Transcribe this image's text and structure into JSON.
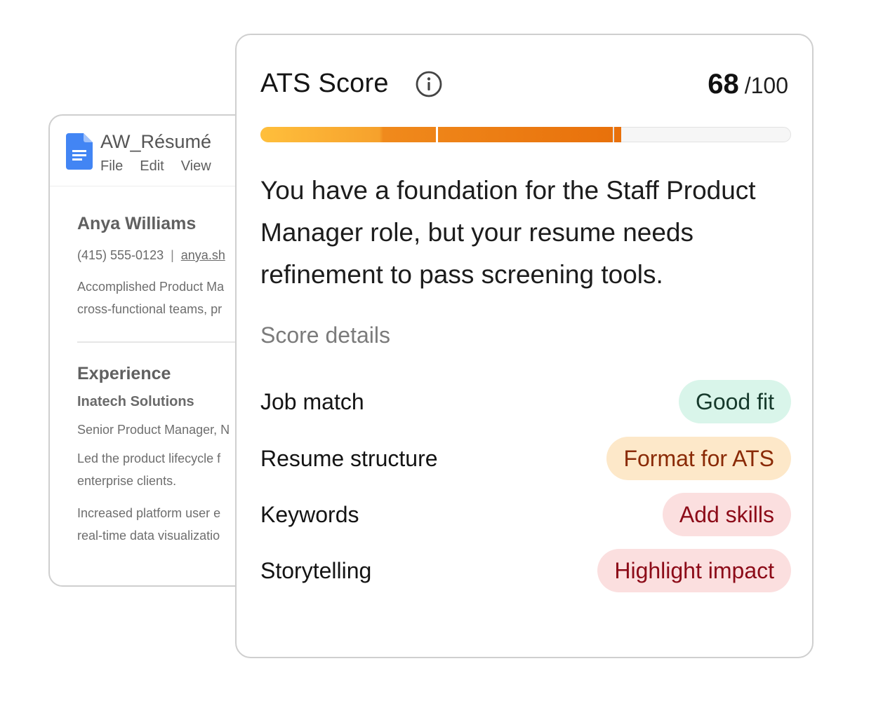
{
  "document": {
    "title": "AW_Résumé",
    "menu": [
      "File",
      "Edit",
      "View"
    ],
    "name": "Anya Williams",
    "phone": "(415) 555-0123",
    "separator": "|",
    "link": "anya.sh",
    "summary_lines": [
      "Accomplished Product Ma",
      "cross-functional teams, pr"
    ],
    "section_heading": "Experience",
    "company": "Inatech Solutions",
    "role": "Senior Product Manager, N",
    "bullet1_lines": [
      "Led the product lifecycle f",
      "enterprise clients."
    ],
    "bullet2_lines": [
      "Increased platform user e",
      "real-time data visualizatio"
    ],
    "icon": "google-docs-icon"
  },
  "ats": {
    "title": "ATS Score",
    "info_icon": "info-icon",
    "score_value": "68",
    "score_max": "/100",
    "progress": 0.68,
    "summary": "You have a foundation for the Staff Product Manager role, but your resume needs refinement to pass screening tools.",
    "details_heading": "Score details",
    "details": [
      {
        "label": "Job match",
        "status": "Good fit",
        "tone": "green"
      },
      {
        "label": "Resume structure",
        "status": "Format for ATS",
        "tone": "orange"
      },
      {
        "label": "Keywords",
        "status": "Add skills",
        "tone": "red"
      },
      {
        "label": "Storytelling",
        "status": "Highlight impact",
        "tone": "red"
      }
    ]
  },
  "colors": {
    "progress_start": "#ffbf3c",
    "progress_end": "#e8700b",
    "good": "#d9f5ea",
    "warning": "#fde8c9",
    "critical": "#fbdfdf"
  }
}
